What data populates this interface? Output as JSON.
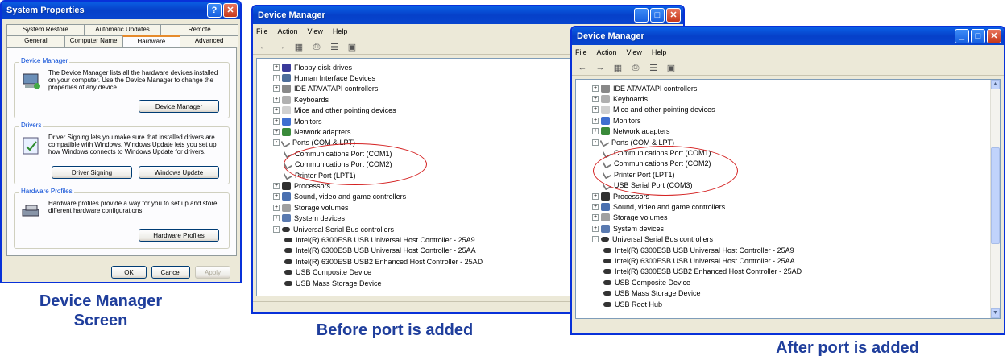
{
  "sysprops": {
    "title": "System Properties",
    "tabs_top": [
      "System Restore",
      "Automatic Updates",
      "Remote"
    ],
    "tabs_bottom": [
      "General",
      "Computer Name",
      "Hardware",
      "Advanced"
    ],
    "device_manager_group": {
      "title": "Device Manager",
      "text": "The Device Manager lists all the hardware devices installed on your computer. Use the Device Manager to change the properties of any device.",
      "button": "Device Manager"
    },
    "drivers_group": {
      "title": "Drivers",
      "text": "Driver Signing lets you make sure that installed drivers are compatible with Windows. Windows Update lets you set up how Windows connects to Windows Update for drivers.",
      "button1": "Driver Signing",
      "button2": "Windows Update"
    },
    "hw_profiles_group": {
      "title": "Hardware Profiles",
      "text": "Hardware profiles provide a way for you to set up and store different hardware configurations.",
      "button": "Hardware Profiles"
    },
    "ok": "OK",
    "cancel": "Cancel",
    "apply": "Apply"
  },
  "dm_before": {
    "title": "Device Manager",
    "menu": [
      "File",
      "Action",
      "View",
      "Help"
    ],
    "tree": [
      {
        "label": "Floppy disk drives",
        "level": 0,
        "exp": "+",
        "icon": "floppy-icon"
      },
      {
        "label": "Human Interface Devices",
        "level": 0,
        "exp": "+",
        "icon": "hid-icon"
      },
      {
        "label": "IDE ATA/ATAPI controllers",
        "level": 0,
        "exp": "+",
        "icon": "ide-icon"
      },
      {
        "label": "Keyboards",
        "level": 0,
        "exp": "+",
        "icon": "keyboard-icon"
      },
      {
        "label": "Mice and other pointing devices",
        "level": 0,
        "exp": "+",
        "icon": "mouse-icon"
      },
      {
        "label": "Monitors",
        "level": 0,
        "exp": "+",
        "icon": "monitor-icon"
      },
      {
        "label": "Network adapters",
        "level": 0,
        "exp": "+",
        "icon": "network-icon"
      },
      {
        "label": "Ports (COM & LPT)",
        "level": 0,
        "exp": "-",
        "icon": "port-icon"
      },
      {
        "label": "Communications Port (COM1)",
        "level": 1,
        "icon": "port-icon"
      },
      {
        "label": "Communications Port (COM2)",
        "level": 1,
        "icon": "port-icon"
      },
      {
        "label": "Printer Port (LPT1)",
        "level": 1,
        "icon": "port-icon"
      },
      {
        "label": "Processors",
        "level": 0,
        "exp": "+",
        "icon": "processor-icon"
      },
      {
        "label": "Sound, video and game controllers",
        "level": 0,
        "exp": "+",
        "icon": "sound-icon"
      },
      {
        "label": "Storage volumes",
        "level": 0,
        "exp": "+",
        "icon": "storage-icon"
      },
      {
        "label": "System devices",
        "level": 0,
        "exp": "+",
        "icon": "system-icon"
      },
      {
        "label": "Universal Serial Bus controllers",
        "level": 0,
        "exp": "-",
        "icon": "usb-icon"
      },
      {
        "label": "Intel(R) 6300ESB USB Universal Host Controller - 25A9",
        "level": 1,
        "icon": "usb-icon"
      },
      {
        "label": "Intel(R) 6300ESB USB Universal Host Controller - 25AA",
        "level": 1,
        "icon": "usb-icon"
      },
      {
        "label": "Intel(R) 6300ESB USB2 Enhanced Host Controller - 25AD",
        "level": 1,
        "icon": "usb-icon"
      },
      {
        "label": "USB Composite Device",
        "level": 1,
        "icon": "usb-icon"
      },
      {
        "label": "USB Mass Storage Device",
        "level": 1,
        "icon": "usb-icon"
      }
    ]
  },
  "dm_after": {
    "title": "Device Manager",
    "menu": [
      "File",
      "Action",
      "View",
      "Help"
    ],
    "tree": [
      {
        "label": "IDE ATA/ATAPI controllers",
        "level": 0,
        "exp": "+",
        "icon": "ide-icon"
      },
      {
        "label": "Keyboards",
        "level": 0,
        "exp": "+",
        "icon": "keyboard-icon"
      },
      {
        "label": "Mice and other pointing devices",
        "level": 0,
        "exp": "+",
        "icon": "mouse-icon"
      },
      {
        "label": "Monitors",
        "level": 0,
        "exp": "+",
        "icon": "monitor-icon"
      },
      {
        "label": "Network adapters",
        "level": 0,
        "exp": "+",
        "icon": "network-icon"
      },
      {
        "label": "Ports (COM & LPT)",
        "level": 0,
        "exp": "-",
        "icon": "port-icon"
      },
      {
        "label": "Communications Port (COM1)",
        "level": 1,
        "icon": "port-icon"
      },
      {
        "label": "Communications Port (COM2)",
        "level": 1,
        "icon": "port-icon"
      },
      {
        "label": "Printer Port (LPT1)",
        "level": 1,
        "icon": "port-icon"
      },
      {
        "label": "USB Serial Port (COM3)",
        "level": 1,
        "icon": "port-icon"
      },
      {
        "label": "Processors",
        "level": 0,
        "exp": "+",
        "icon": "processor-icon"
      },
      {
        "label": "Sound, video and game controllers",
        "level": 0,
        "exp": "+",
        "icon": "sound-icon"
      },
      {
        "label": "Storage volumes",
        "level": 0,
        "exp": "+",
        "icon": "storage-icon"
      },
      {
        "label": "System devices",
        "level": 0,
        "exp": "+",
        "icon": "system-icon"
      },
      {
        "label": "Universal Serial Bus controllers",
        "level": 0,
        "exp": "-",
        "icon": "usb-icon"
      },
      {
        "label": "Intel(R) 6300ESB USB Universal Host Controller - 25A9",
        "level": 1,
        "icon": "usb-icon"
      },
      {
        "label": "Intel(R) 6300ESB USB Universal Host Controller - 25AA",
        "level": 1,
        "icon": "usb-icon"
      },
      {
        "label": "Intel(R) 6300ESB USB2 Enhanced Host Controller - 25AD",
        "level": 1,
        "icon": "usb-icon"
      },
      {
        "label": "USB Composite Device",
        "level": 1,
        "icon": "usb-icon"
      },
      {
        "label": "USB Mass Storage Device",
        "level": 1,
        "icon": "usb-icon"
      },
      {
        "label": "USB Root Hub",
        "level": 1,
        "icon": "usb-icon"
      }
    ]
  },
  "captions": {
    "left_line1": "Device Manager",
    "left_line2": "Screen",
    "middle": "Before port is added",
    "right": "After port is added"
  },
  "colors": {
    "caption": "#1f3e9c",
    "highlight_oval": "#d42020",
    "titlebar": "#0a5fe4"
  }
}
